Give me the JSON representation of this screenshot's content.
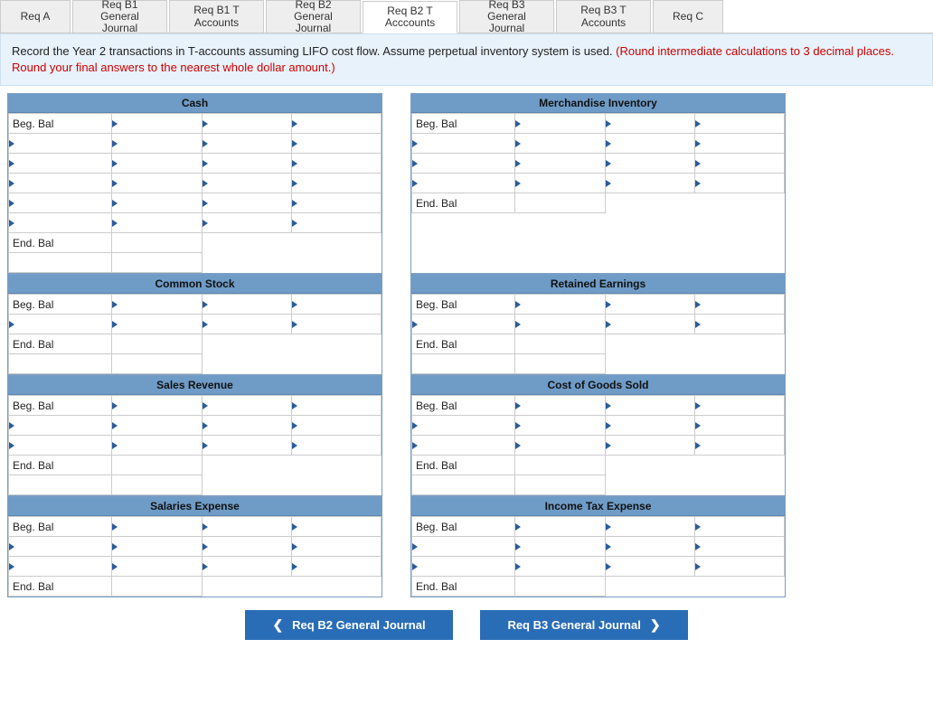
{
  "tabs": [
    {
      "label": "Req A",
      "active": false,
      "w": "s"
    },
    {
      "label": "Req B1 General\nJournal",
      "active": false,
      "w": "m"
    },
    {
      "label": "Req B1 T\nAccounts",
      "active": false,
      "w": "m"
    },
    {
      "label": "Req B2 General\nJournal",
      "active": false,
      "w": "m"
    },
    {
      "label": "Req B2 T\nAcccounts",
      "active": true,
      "w": "m"
    },
    {
      "label": "Req B3 General\nJournal",
      "active": false,
      "w": "m"
    },
    {
      "label": "Req B3 T\nAccounts",
      "active": false,
      "w": "m"
    },
    {
      "label": "Req C",
      "active": false,
      "w": "s"
    }
  ],
  "instructions": {
    "black": "Record the Year 2 transactions in T-accounts assuming LIFO cost flow. Assume perpetual inventory system is used. ",
    "red": "(Round intermediate calculations to 3 decimal places. Round your final answers to the nearest whole dollar amount.)"
  },
  "labels": {
    "beg": "Beg. Bal",
    "end": "End. Bal"
  },
  "accounts": {
    "cash": {
      "title": "Cash",
      "body_rows": 6,
      "tail_blanks": 1
    },
    "merch": {
      "title": "Merchandise Inventory",
      "body_rows": 4,
      "tail_blanks": 0
    },
    "common": {
      "title": "Common Stock",
      "body_rows": 2,
      "tail_blanks": 1
    },
    "retained": {
      "title": "Retained Earnings",
      "body_rows": 2,
      "tail_blanks": 1
    },
    "sales": {
      "title": "Sales Revenue",
      "body_rows": 3,
      "tail_blanks": 1
    },
    "cogs": {
      "title": "Cost of Goods Sold",
      "body_rows": 3,
      "tail_blanks": 1
    },
    "salaries": {
      "title": "Salaries Expense",
      "body_rows": 3,
      "tail_blanks": 0
    },
    "tax": {
      "title": "Income Tax Expense",
      "body_rows": 3,
      "tail_blanks": 0
    }
  },
  "nav": {
    "prev": "Req B2 General Journal",
    "next": "Req B3 General Journal"
  }
}
